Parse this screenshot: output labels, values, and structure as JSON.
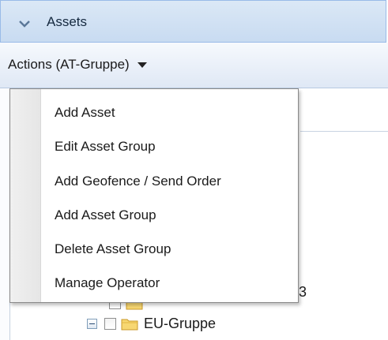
{
  "panel": {
    "title": "Assets",
    "collapse_icon": "chevron-down-icon"
  },
  "toolbar": {
    "actions_label": "Actions (AT-Gruppe)"
  },
  "menu": {
    "items": [
      {
        "label": "Add Asset"
      },
      {
        "label": "Edit Asset Group"
      },
      {
        "label": "Add Geofence / Send Order"
      },
      {
        "label": "Add Asset Group"
      },
      {
        "label": "Delete Asset Group"
      },
      {
        "label": "Manage Operator"
      }
    ]
  },
  "tree": {
    "partial_node_tail": "3",
    "nodes": [
      {
        "label": "EU-Gruppe",
        "expander_icon": "collapse-minus-icon",
        "folder_icon": "folder-icon"
      }
    ]
  },
  "colors": {
    "header_bg": "#c8dbf1",
    "header_border": "#99bbe8",
    "folder": "#f5c84c"
  }
}
